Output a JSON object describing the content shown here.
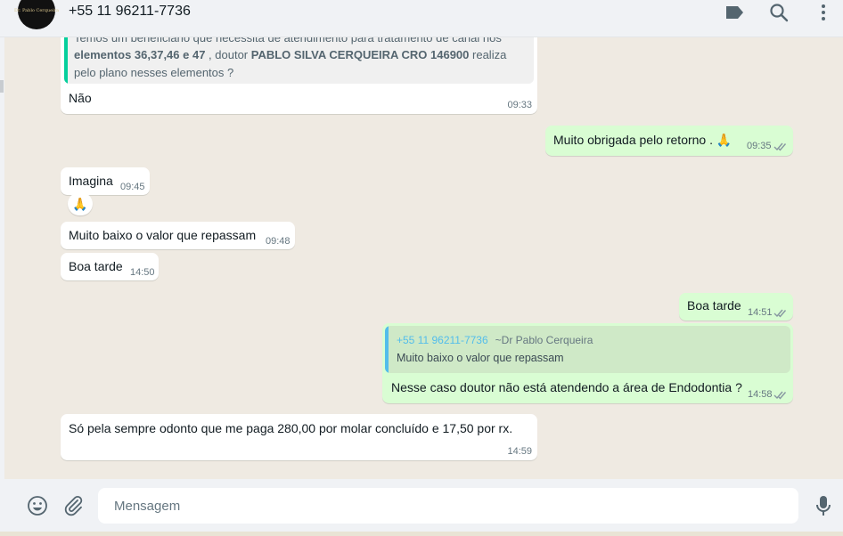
{
  "header": {
    "contact_name": "+55 11 96211-7736",
    "avatar_text": "Dr. Pablo Cerqueira",
    "icons": [
      "label-icon",
      "search-icon",
      "menu-icon"
    ]
  },
  "messages": [
    {
      "id": "m1",
      "direction": "in",
      "quote": {
        "line1_partial": "Temos um beneficiário que necessita de atendimento para tratamento de canal nos",
        "line2_bold1": "elementos 36,37,46 e 47",
        "line2_normal": " , doutor ",
        "line2_bold2": "PABLO SILVA CERQUEIRA  CRO 146900",
        "line2_tail": " realiza",
        "line3": "pelo plano nesses elementos ?"
      },
      "text": "Não",
      "time": "09:33"
    },
    {
      "id": "m2",
      "direction": "out",
      "text": "Muito obrigada pelo retorno . 🙏",
      "time": "09:35",
      "status": "read"
    },
    {
      "id": "m3",
      "direction": "in",
      "text": "Imagina",
      "time": "09:45",
      "reaction": "🙏"
    },
    {
      "id": "m4",
      "direction": "in",
      "text": "Muito baixo o valor que repassam",
      "time": "09:48"
    },
    {
      "id": "m5",
      "direction": "in",
      "text": "Boa tarde",
      "time": "14:50"
    },
    {
      "id": "m6",
      "direction": "out",
      "text": "Boa tarde",
      "time": "14:51",
      "status": "read"
    },
    {
      "id": "m7",
      "direction": "out",
      "quote": {
        "author": "+55 11 96211-7736",
        "author_alias": "~Dr Pablo Cerqueira",
        "text": "Muito baixo o valor que repassam"
      },
      "text": "Nesse caso doutor não está atendendo a área de Endodontia ?",
      "time": "14:58",
      "status": "read"
    },
    {
      "id": "m8",
      "direction": "in",
      "text": "Só pela sempre odonto que me paga 280,00 por molar concluído e 17,50 por rx.",
      "time": "14:59"
    }
  ],
  "composer": {
    "placeholder": "Mensagem",
    "icons": [
      "emoji-icon",
      "attach-icon",
      "mic-icon"
    ]
  },
  "colors": {
    "incoming": "#ffffff",
    "outgoing": "#d9fdd3",
    "read_ticks": "#53bdeb",
    "quote_bar_in": "#06cf9c",
    "quote_author": "#53bdeb"
  }
}
